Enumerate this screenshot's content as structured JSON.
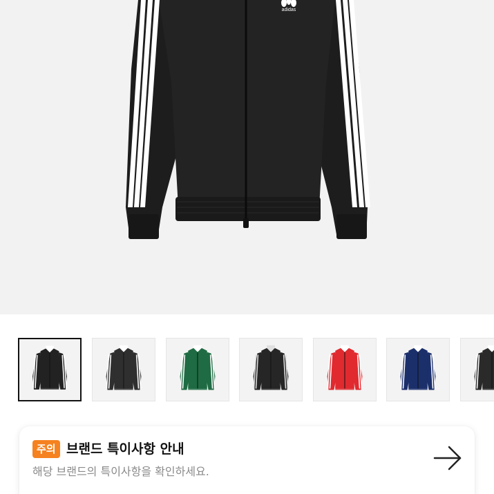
{
  "product": {
    "image_icon": "black-track-jacket-image",
    "logo_text": "adidas",
    "thumbnails": [
      {
        "icon": "black-track-jacket-thumbnail",
        "body_color": "#222222",
        "trim_color": "#ffffff",
        "selected": true
      },
      {
        "icon": "black-white-track-jacket-thumbnail",
        "body_color": "#2f2f2f",
        "trim_color": "#ffffff",
        "selected": false
      },
      {
        "icon": "green-track-jacket-thumbnail",
        "body_color": "#1f6b43",
        "trim_color": "#ffffff",
        "selected": false
      },
      {
        "icon": "black-track-jacket-thumbnail",
        "body_color": "#262626",
        "trim_color": "#e0e0e0",
        "selected": false
      },
      {
        "icon": "red-track-jacket-thumbnail",
        "body_color": "#e02a2f",
        "trim_color": "#ffffff",
        "selected": false
      },
      {
        "icon": "navy-track-jacket-thumbnail",
        "body_color": "#1b2f6b",
        "trim_color": "#ffffff",
        "selected": false
      },
      {
        "icon": "black-track-jacket-thumbnail",
        "body_color": "#2a2a2a",
        "trim_color": "#ffffff",
        "selected": false
      }
    ]
  },
  "notice": {
    "badge": "주의",
    "title": "브랜드 특이사항 안내",
    "subtitle": "해당 브랜드의 특이사항을 확인하세요.",
    "arrow_icon": "arrow-right-icon",
    "badge_color": "#f5821f"
  }
}
